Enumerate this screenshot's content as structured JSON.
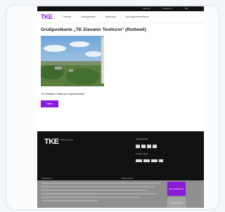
{
  "header": {
    "utility_links": [
      "Karriere",
      "Newsroom",
      "DE"
    ],
    "logo": "TKE",
    "nav": [
      "Themen",
      "Aufzugsarten",
      "Branchen",
      "Aufzugsunternehmen"
    ]
  },
  "main": {
    "title": "Grußpostkarte „TK Elevator Testturm“ (Rottweil)",
    "caption": "TK Elevator Testturm Impressionen",
    "button_label": "Teilen"
  },
  "footer": {
    "logo": "TKE",
    "slogan": "Move beyond",
    "social_heading": "Social Media",
    "apps_heading": "Unsere Apps",
    "legal_left": "Impressum",
    "legal_right": "Datenschutz"
  },
  "cookie": {
    "accept_label": "Alle akzeptieren",
    "settings_label": "Einstellungen"
  },
  "colors": {
    "brand_purple": "#8a1bd9",
    "footer_black": "#111111"
  }
}
